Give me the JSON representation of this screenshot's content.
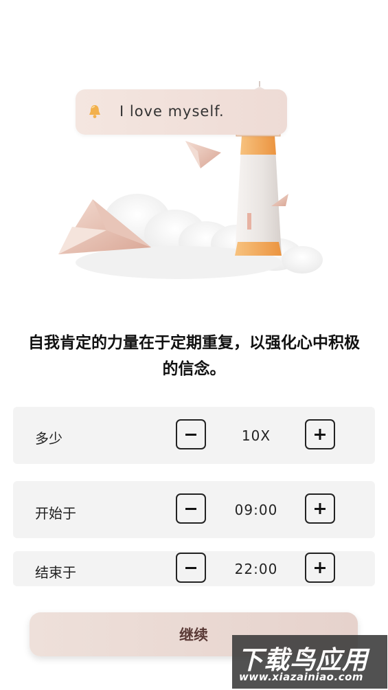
{
  "quote": {
    "text": "I love myself.",
    "icon": "bell-icon"
  },
  "headline": {
    "line1": "自我肯定的力量在于定期重复，以强化心中积极",
    "line2": "的信念。"
  },
  "settings": [
    {
      "label": "多少",
      "value": "10X"
    },
    {
      "label": "开始于",
      "value": "09:00"
    },
    {
      "label": "结束于",
      "value": "22:00"
    }
  ],
  "continue_label": "继续",
  "watermark": {
    "main": "下载鸟应用",
    "url": "www.xiazainiao.com"
  },
  "colors": {
    "accent": "#e8d6d0",
    "button_text": "#5a3a36",
    "row_bg": "#f3f3f3",
    "lighthouse_orange": "#f0a04a"
  }
}
